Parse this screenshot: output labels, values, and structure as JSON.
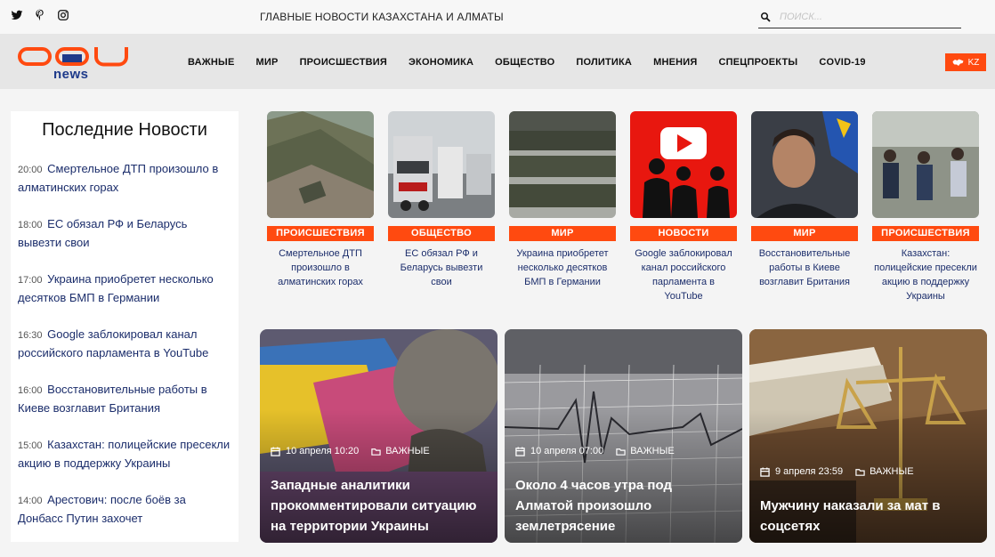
{
  "topbar": {
    "tagline": "ГЛАВНЫЕ НОВОСТИ КАЗАХСТАНА И АЛМАТЫ",
    "search_placeholder": "ПОИСК...",
    "social": [
      "twitter-icon",
      "pinterest-icon",
      "instagram-icon"
    ]
  },
  "header": {
    "logo_sub": "news",
    "nav": [
      "ВАЖНЫЕ",
      "МИР",
      "ПРОИСШЕСТВИЯ",
      "ЭКОНОМИКА",
      "ОБЩЕСТВО",
      "ПОЛИТИКА",
      "МНЕНИЯ",
      "СПЕЦПРОЕКТЫ",
      "COVID-19"
    ],
    "lang": "KZ",
    "accent_color": "#ff4a10",
    "link_color": "#1b2d6b"
  },
  "sidebar": {
    "title": "Последние Новости",
    "items": [
      {
        "time": "20:00",
        "text": "Смертельное ДТП произошло в алматинских горах"
      },
      {
        "time": "18:00",
        "text": "ЕС обязал РФ и Беларусь вывезти свои"
      },
      {
        "time": "17:00",
        "text": "Украина приобретет несколько десятков БМП в Германии"
      },
      {
        "time": "16:30",
        "text": "Google заблокировал канал российского парламента в YouTube"
      },
      {
        "time": "16:00",
        "text": "Восстановительные работы в Киеве возглавит Британия"
      },
      {
        "time": "15:00",
        "text": "Казахстан: полицейские пресекли акцию в поддержку Украины"
      },
      {
        "time": "14:00",
        "text": "Арестович: после боёв за Донбасс Путин захочет"
      }
    ]
  },
  "cards": [
    {
      "category": "ПРОИСШЕСТВИЯ",
      "title": "Смертельное ДТП произошло в алматинских горах"
    },
    {
      "category": "ОБЩЕСТВО",
      "title": "ЕС обязал РФ и Беларусь вывезти свои"
    },
    {
      "category": "МИР",
      "title": "Украина приобретет несколько десятков БМП в Германии"
    },
    {
      "category": "НОВОСТИ",
      "title": "Google заблокировал канал российского парламента в YouTube"
    },
    {
      "category": "МИР",
      "title": "Восстановительные работы в Киеве возглавит Британия"
    },
    {
      "category": "ПРОИСШЕСТВИЯ",
      "title": "Казахстан: полицейские пресекли акцию в поддержку Украины"
    }
  ],
  "featured": [
    {
      "date": "10 апреля 10:20",
      "category": "ВАЖНЫЕ",
      "title": "Западные аналитики прокомментировали ситуацию на территории Украины"
    },
    {
      "date": "10 апреля 07:00",
      "category": "ВАЖНЫЕ",
      "title": "Около 4 часов утра под Алматой произошло землетрясение"
    },
    {
      "date": "9 апреля 23:59",
      "category": "ВАЖНЫЕ",
      "title": "Мужчину наказали за мат в соцсетях"
    }
  ]
}
